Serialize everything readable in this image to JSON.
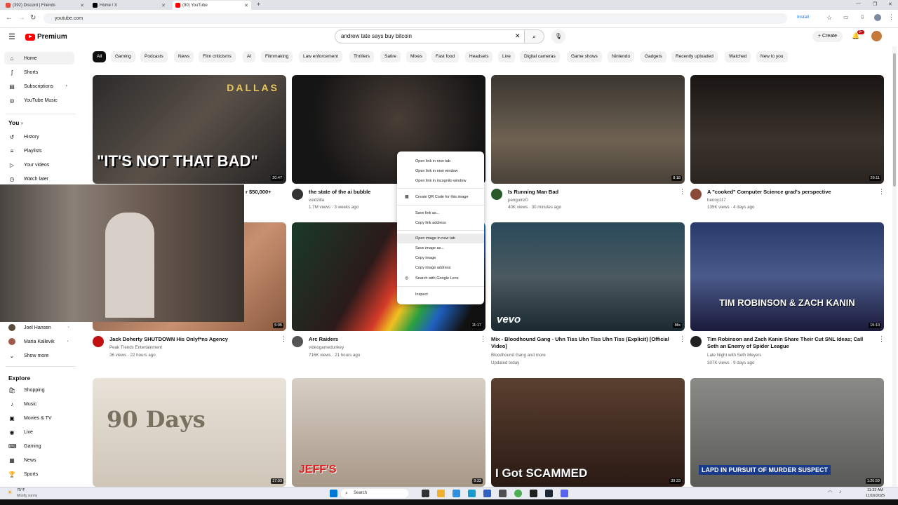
{
  "browser": {
    "tabs": [
      {
        "title": "(392) Discord | Friends",
        "color": "#e84a3c"
      },
      {
        "title": "Home / X",
        "color": "#000000"
      },
      {
        "title": "(90) YouTube",
        "color": "#ff0000"
      }
    ],
    "url": "youtube.com",
    "install_label": "Install"
  },
  "header": {
    "logo_text": "Premium",
    "search_query": "andrew tate says buy bitcoin",
    "create_label": "Create",
    "notif_badge": "9+"
  },
  "sidebar": {
    "main": [
      {
        "label": "Home",
        "icon": "home-icon"
      },
      {
        "label": "Shorts",
        "icon": "shorts-icon"
      },
      {
        "label": "Subscriptions",
        "icon": "subscriptions-icon"
      },
      {
        "label": "YouTube Music",
        "icon": "music-icon"
      }
    ],
    "you_heading": "You",
    "you": [
      {
        "label": "History"
      },
      {
        "label": "Playlists"
      },
      {
        "label": "Your videos"
      },
      {
        "label": "Watch later"
      }
    ],
    "subs": [
      {
        "label": "Joel Hansen"
      },
      {
        "label": "Maria Kallevik"
      }
    ],
    "show_more": "Show more",
    "explore_heading": "Explore",
    "explore": [
      {
        "label": "Shopping"
      },
      {
        "label": "Music"
      },
      {
        "label": "Movies & TV"
      },
      {
        "label": "Live"
      },
      {
        "label": "Gaming"
      },
      {
        "label": "News"
      },
      {
        "label": "Sports"
      }
    ]
  },
  "chips": [
    "All",
    "Gaming",
    "Podcasts",
    "News",
    "Film criticisms",
    "AI",
    "Filmmaking",
    "Law enforcement",
    "Thrillers",
    "Satire",
    "Mixes",
    "Fast food",
    "Headsets",
    "Live",
    "Digital cameras",
    "Game shows",
    "Nintendo",
    "Gadgets",
    "Recently uploaded",
    "Watched",
    "New to you"
  ],
  "videos": [
    {
      "title": "r $50,000+",
      "channel": "",
      "meta": "",
      "duration": "20:47",
      "overlay": "\"IT'S NOT THAT BAD\""
    },
    {
      "title": "the state of the ai bubble",
      "channel": "voidzilla",
      "meta": "1.7M views · 3 weeks ago",
      "duration": ""
    },
    {
      "title": "Is Running Man Bad",
      "channel": "penguinz0",
      "meta": "40K views · 30 minutes ago",
      "duration": "8:18"
    },
    {
      "title": "A \"cooked\" Computer Science grad's perspective",
      "channel": "henny117",
      "meta": "135K views · 4 days ago",
      "duration": "26:11"
    },
    {
      "title": "Jack Doherty SHUTDOWN His Onlyf*ns Agency",
      "channel": "Peak Trends Entertainment",
      "meta": "36 views · 22 hours ago",
      "duration": "5:05"
    },
    {
      "title": "Arc Raiders",
      "channel": "videogamedunkey",
      "meta": "716K views · 21 hours ago",
      "duration": "11:17"
    },
    {
      "title": "Mix - Bloodhound Gang - Uhn Tiss Uhn Tiss Uhn Tiss (Explicit) [Official Video]",
      "channel": "Bloodhound Gang and more",
      "meta": "Updated today",
      "duration": "Mix",
      "overlay": "vevo"
    },
    {
      "title": "Tim Robinson and Zach Kanin Share Their Cut SNL Ideas; Call Seth an Enemy of Spider League",
      "channel": "Late Night with Seth Meyers",
      "meta": "307K views · 9 days ago",
      "duration": "15:10",
      "overlay": "TIM ROBINSON & ZACH KANIN"
    },
    {
      "title": "",
      "channel": "",
      "meta": "",
      "duration": "17:03",
      "overlay": "90 Days"
    },
    {
      "title": "",
      "channel": "",
      "meta": "",
      "duration": "9:33",
      "overlay": "JEFF'S"
    },
    {
      "title": "",
      "channel": "",
      "meta": "",
      "duration": "39:33",
      "overlay": "I Got SCAMMED"
    },
    {
      "title": "",
      "channel": "",
      "meta": "",
      "duration": "1:20:59",
      "overlay": "LAPD IN PURSUIT OF MURDER SUSPECT"
    }
  ],
  "context_menu": [
    "Open link in new tab",
    "Open link in new window",
    "Open link in incognito window",
    "Create QR Code for this image",
    "Save link as...",
    "Copy link address",
    "Open image in new tab",
    "Save image as...",
    "Copy image",
    "Copy image address",
    "Search with Google Lens",
    "Inspect"
  ],
  "taskbar": {
    "weather_temp": "75°F",
    "weather_desc": "Mostly sunny",
    "search_placeholder": "Search",
    "time": "11:33 AM",
    "date": "11/16/2025"
  }
}
